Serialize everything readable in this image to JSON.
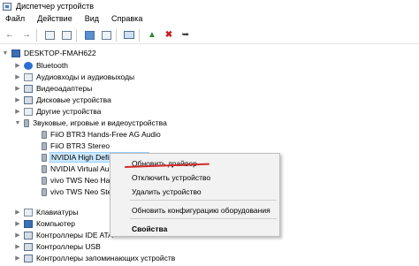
{
  "window": {
    "title": "Диспетчер устройств"
  },
  "menu": [
    "Файл",
    "Действие",
    "Вид",
    "Справка"
  ],
  "toolbar": {
    "icons": [
      "back-arrow-icon",
      "forward-arrow-icon",
      "properties-icon",
      "view-icon",
      "help-icon",
      "display-icon",
      "update-driver-icon",
      "uninstall-icon",
      "download-icon"
    ]
  },
  "tree": {
    "root": "DESKTOP-FMAH622",
    "items": [
      "Bluetooth",
      "Аудиовходы и аудиовыходы",
      "Видеоадаптеры",
      "Дисковые устройства",
      "Другие устройства",
      "Звуковые, игровые и видеоустройства",
      "FiiO BTR3 Hands-Free AG Audio",
      "FiiO BTR3 Stereo",
      "NVIDIA High Definition Audio",
      "NVIDIA Virtual Au",
      "vivo TWS Neo Ha",
      "vivo TWS Neo Ste",
      "Клавиатуры",
      "Компьютер",
      "Контроллеры IDE ATA",
      "Контроллеры USB",
      "Контроллеры запоминающих устройств"
    ]
  },
  "context_menu": {
    "update_driver": "Обновить драйвер",
    "disable": "Отключить устройство",
    "uninstall": "Удалить устройство",
    "scan": "Обновить конфигурацию оборудования",
    "properties": "Свойства"
  },
  "colors": {
    "selection": "#cce8ff",
    "annotation": "#d22a2a"
  }
}
